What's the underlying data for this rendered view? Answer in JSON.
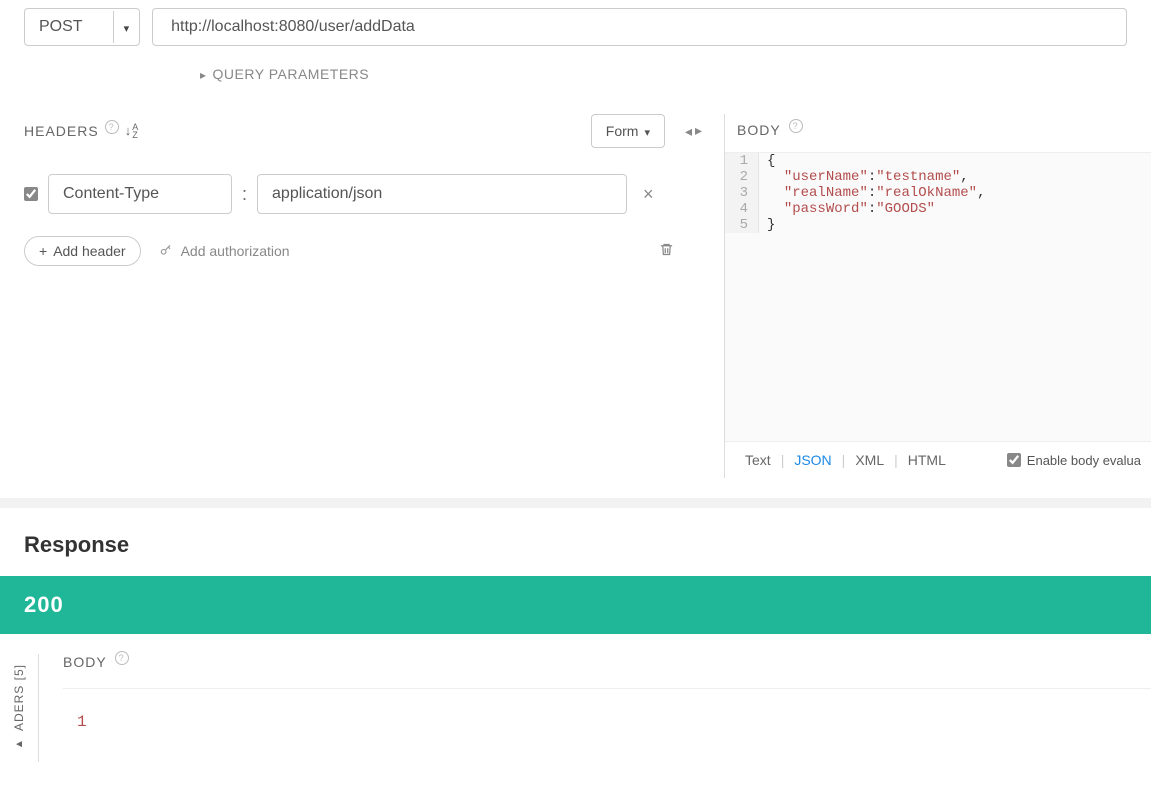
{
  "request": {
    "method": "POST",
    "url": "http://localhost:8080/user/addData"
  },
  "queryParams": {
    "label": "QUERY PARAMETERS"
  },
  "headersSection": {
    "title": "HEADERS",
    "sortLabel": "↓A-Z",
    "formLabel": "Form"
  },
  "headers": [
    {
      "enabled": true,
      "name": "Content-Type",
      "value": "application/json"
    }
  ],
  "actions": {
    "addHeader": "Add header",
    "addAuthorization": "Add authorization"
  },
  "bodySection": {
    "title": "BODY",
    "lines": [
      {
        "n": "1",
        "raw": "{"
      },
      {
        "n": "2",
        "key": "userName",
        "value": "testname",
        "comma": true
      },
      {
        "n": "3",
        "key": "realName",
        "value": "realOkName",
        "comma": true
      },
      {
        "n": "4",
        "key": "passWord",
        "value": "GOODS",
        "comma": false
      },
      {
        "n": "5",
        "raw": "}"
      }
    ],
    "tabs": {
      "text": "Text",
      "json": "JSON",
      "xml": "XML",
      "html": "HTML"
    },
    "activeTab": "json",
    "enableEval": "Enable body evalua"
  },
  "response": {
    "title": "Response",
    "status": "200",
    "headersTab": "ADERS [5]",
    "bodyTitle": "BODY",
    "bodyContent": "1"
  }
}
